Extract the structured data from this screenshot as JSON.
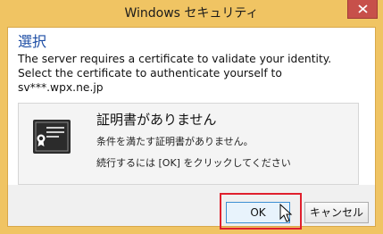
{
  "window": {
    "title": "Windows セキュリティ",
    "close_icon": "close-icon"
  },
  "dialog": {
    "heading": "選択",
    "description": "The server requires a certificate to validate your identity. Select the certificate to authenticate yourself to sv***.wpx.ne.jp"
  },
  "certificate": {
    "icon": "certificate-icon",
    "title": "証明書がありません",
    "message": "条件を満たす証明書がありません。",
    "instruction": "続行するには [OK] をクリックしてください"
  },
  "buttons": {
    "ok_label": "OK",
    "cancel_label": "キャンセル"
  },
  "colors": {
    "frame": "#f0c463",
    "heading": "#1e4ea5",
    "close_button": "#c7504a",
    "highlight": "#e0202d"
  }
}
